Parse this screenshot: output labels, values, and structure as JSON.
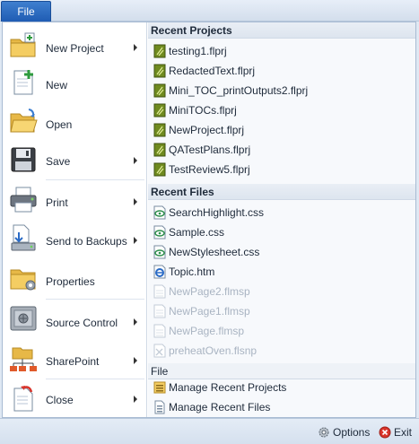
{
  "tab": {
    "label": "File"
  },
  "commands": [
    {
      "id": "new-project",
      "label": "New Project",
      "icon": "folder-new-icon",
      "has_submenu": true
    },
    {
      "id": "new",
      "label": "New",
      "icon": "new-document-icon",
      "has_submenu": false
    },
    {
      "id": "open",
      "label": "Open",
      "icon": "folder-open-icon",
      "has_submenu": false
    },
    {
      "id": "save",
      "label": "Save",
      "icon": "floppy-disk-icon",
      "has_submenu": true
    },
    {
      "id": "print",
      "label": "Print",
      "icon": "printer-icon",
      "has_submenu": true
    },
    {
      "id": "send-to-backups",
      "label": "Send to Backups",
      "icon": "backup-icon",
      "has_submenu": true
    },
    {
      "id": "properties",
      "label": "Properties",
      "icon": "folder-gear-icon",
      "has_submenu": false
    },
    {
      "id": "source-control",
      "label": "Source Control",
      "icon": "safe-icon",
      "has_submenu": true
    },
    {
      "id": "sharepoint",
      "label": "SharePoint",
      "icon": "network-icon",
      "has_submenu": true
    },
    {
      "id": "close",
      "label": "Close",
      "icon": "close-document-icon",
      "has_submenu": true
    }
  ],
  "recent_projects": {
    "title": "Recent Projects",
    "items": [
      "testing1.flprj",
      "RedactedText.flprj",
      "Mini_TOC_printOutputs2.flprj",
      "MiniTOCs.flprj",
      "NewProject.flprj",
      "QATestPlans.flprj",
      "TestReview5.flprj"
    ]
  },
  "recent_files": {
    "title": "Recent Files",
    "items": [
      {
        "name": "SearchHighlight.css",
        "icon": "css-icon",
        "enabled": true
      },
      {
        "name": "Sample.css",
        "icon": "css-icon",
        "enabled": true
      },
      {
        "name": "NewStylesheet.css",
        "icon": "css-icon",
        "enabled": true
      },
      {
        "name": "Topic.htm",
        "icon": "html-icon",
        "enabled": true
      },
      {
        "name": "NewPage2.flmsp",
        "icon": "page-icon",
        "enabled": false
      },
      {
        "name": "NewPage1.flmsp",
        "icon": "page-icon",
        "enabled": false
      },
      {
        "name": "NewPage.flmsp",
        "icon": "page-icon",
        "enabled": false
      },
      {
        "name": "preheatOven.flsnp",
        "icon": "snippet-icon",
        "enabled": false
      }
    ]
  },
  "file_section": {
    "title": "File",
    "items": [
      {
        "label": "Manage Recent Projects",
        "icon": "manage-projects-icon"
      },
      {
        "label": "Manage Recent Files",
        "icon": "manage-files-icon"
      }
    ]
  },
  "footer": {
    "options_label": "Options",
    "exit_label": "Exit"
  },
  "colors": {
    "accent": "#2a6bc6",
    "project_icon": "#6f8a1f",
    "css_icon": "#2f8f4e",
    "exit_icon": "#d9342b"
  }
}
